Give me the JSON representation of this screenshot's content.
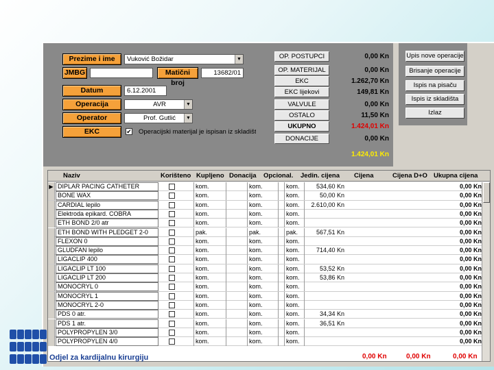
{
  "form": {
    "prezime_label": "Prezime i ime",
    "prezime_value": "Vuković Božidar",
    "jmbg_label": "JMBG",
    "jmbg_value": "",
    "maticni_label": "Matični broj",
    "maticni_value": "13682/01",
    "datum_label": "Datum",
    "datum_value": "6.12.2001",
    "operacija_label": "Operacija",
    "operacija_value": "AVR",
    "operator_label": "Operator",
    "operator_value": "Prof. Gutlić",
    "ekc_label": "EKC",
    "checkbox_label": "Operacijski materijal je ispisan iz skladišta",
    "checkbox_mark": "✔"
  },
  "costs": {
    "items": [
      {
        "label": "OP. POSTUPCI",
        "value": "0,00 Kn",
        "style": "normal"
      },
      {
        "label": "OP. MATERIJAL",
        "value": "0,00 Kn",
        "style": "normal"
      },
      {
        "label": "EKC",
        "value": "1.262,70 Kn",
        "style": "normal"
      },
      {
        "label": "EKC lijekovi",
        "value": "149,81 Kn",
        "style": "normal"
      },
      {
        "label": "VALVULE",
        "value": "0,00 Kn",
        "style": "normal"
      },
      {
        "label": "OSTALO",
        "value": "11,50 Kn",
        "style": "normal"
      },
      {
        "label": "UKUPNO",
        "value": "1.424,01 Kn",
        "style": "red"
      },
      {
        "label": "DONACIJE",
        "value": "0,00 Kn",
        "style": "normal"
      }
    ],
    "net_total": "1.424,01 Kn"
  },
  "actions": [
    "Upis nove operacije",
    "Brisanje operacije",
    "Ispis na pisaču",
    "Ispis iz skladišta",
    "Izlaz"
  ],
  "grid": {
    "columns": [
      "Naziv",
      "Korišteno",
      "Kupljeno",
      "Donacija",
      "Opcional.",
      "Jedin. cijena",
      "Cijena",
      "Cijena D+O",
      "Ukupna cijena"
    ],
    "row_indicator": "▶",
    "rows": [
      {
        "naziv": "DIPLAR PACING CATHETER",
        "don": "kom.",
        "opc": "kom.",
        "jed": "kom.",
        "cijena": "534,60 Kn",
        "ukupno": "0,00 Kn"
      },
      {
        "naziv": "BONE WAX",
        "don": "kom.",
        "opc": "kom.",
        "jed": "kom.",
        "cijena": "50,00 Kn",
        "ukupno": "0,00 Kn"
      },
      {
        "naziv": "CARDIAL lepilo",
        "don": "kom.",
        "opc": "kom.",
        "jed": "kom.",
        "cijena": "2.610,00 Kn",
        "ukupno": "0,00 Kn"
      },
      {
        "naziv": "Elektroda epikard. COBRA",
        "don": "kom.",
        "opc": "kom.",
        "jed": "kom.",
        "cijena": "",
        "ukupno": "0,00 Kn"
      },
      {
        "naziv": "ETH BOND 2/0 atr",
        "don": "kom.",
        "opc": "kom.",
        "jed": "kom.",
        "cijena": "",
        "ukupno": "0,00 Kn"
      },
      {
        "naziv": "ETH BOND WITH PLEDGET 2-0",
        "don": "pak.",
        "opc": "pak.",
        "jed": "pak.",
        "cijena": "567,51 Kn",
        "ukupno": "0,00 Kn"
      },
      {
        "naziv": "FLEXON 0",
        "don": "kom.",
        "opc": "kom.",
        "jed": "kom.",
        "cijena": "",
        "ukupno": "0,00 Kn"
      },
      {
        "naziv": "GLUDFAN lepilo",
        "don": "kom.",
        "opc": "kom.",
        "jed": "kom.",
        "cijena": "714,40 Kn",
        "ukupno": "0,00 Kn"
      },
      {
        "naziv": "LIGACLIP 400",
        "don": "kom.",
        "opc": "kom.",
        "jed": "kom.",
        "cijena": "",
        "ukupno": "0,00 Kn"
      },
      {
        "naziv": "LIGACLIP LT 100",
        "don": "kom.",
        "opc": "kom.",
        "jed": "kom.",
        "cijena": "53,52 Kn",
        "ukupno": "0,00 Kn"
      },
      {
        "naziv": "LIGACLIP LT 200",
        "don": "kom.",
        "opc": "kom.",
        "jed": "kom.",
        "cijena": "53,86 Kn",
        "ukupno": "0,00 Kn"
      },
      {
        "naziv": "MONOCRYL 0",
        "don": "kom.",
        "opc": "kom.",
        "jed": "kom.",
        "cijena": "",
        "ukupno": "0,00 Kn"
      },
      {
        "naziv": "MONOCRYL 1",
        "don": "kom.",
        "opc": "kom.",
        "jed": "kom.",
        "cijena": "",
        "ukupno": "0,00 Kn"
      },
      {
        "naziv": "MONOCRYL 2-0",
        "don": "kom.",
        "opc": "kom.",
        "jed": "kom.",
        "cijena": "",
        "ukupno": "0,00 Kn"
      },
      {
        "naziv": "PDS 0 atr.",
        "don": "kom.",
        "opc": "kom.",
        "jed": "kom.",
        "cijena": "34,34 Kn",
        "ukupno": "0,00 Kn"
      },
      {
        "naziv": "PDS 1 atr.",
        "don": "kom.",
        "opc": "kom.",
        "jed": "kom.",
        "cijena": "36,51 Kn",
        "ukupno": "0,00 Kn"
      },
      {
        "naziv": "POLYPROPYLEN 3/0",
        "don": "kom.",
        "opc": "kom.",
        "jed": "kom.",
        "cijena": "",
        "ukupno": "0,00 Kn"
      },
      {
        "naziv": "POLYPROPYLEN 4/0",
        "don": "kom.",
        "opc": "kom.",
        "jed": "kom.",
        "cijena": "",
        "ukupno": "0,00 Kn"
      }
    ],
    "totals": {
      "cijena": "0,00 Kn",
      "cijena_do": "0,00 Kn",
      "ukupno": "0,00 Kn"
    }
  },
  "organization": "Odjel za kardijalnu kirurgiju",
  "colors": {
    "label_orange": "#f5a13a",
    "panel_gray": "#898989",
    "total_red": "#e00000",
    "total_yellow": "#ffee00",
    "logo_blue": "#1f4fa8"
  }
}
